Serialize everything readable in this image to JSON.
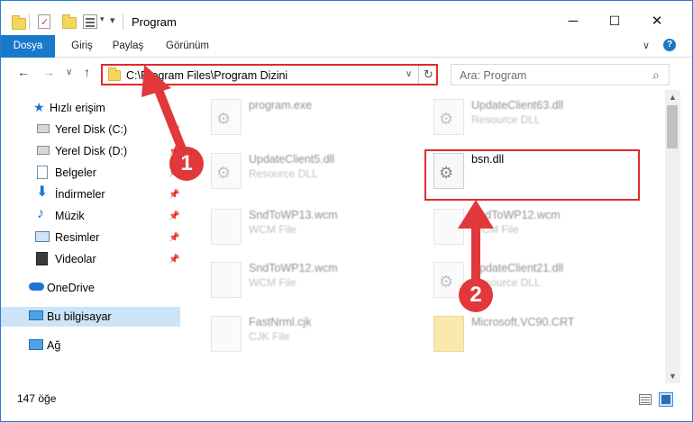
{
  "window": {
    "title": "Program",
    "minimize": "─",
    "maximize": "☐",
    "close": "✕",
    "ribbon_expand": "∨",
    "help": "?"
  },
  "ribbon": {
    "tabs": [
      {
        "label": "Dosya",
        "active": true
      },
      {
        "label": "Giriş",
        "active": false
      },
      {
        "label": "Paylaş",
        "active": false
      },
      {
        "label": "Görünüm",
        "active": false
      }
    ]
  },
  "addressbar": {
    "path": "C:\\Program Files\\Program Dizini",
    "back": "←",
    "forward": "→",
    "recent": "∨",
    "up": "↑",
    "dropdown": "∨",
    "refresh": "↻"
  },
  "search": {
    "placeholder": "Ara: Program",
    "icon": "⌕"
  },
  "sidebar": {
    "items": [
      {
        "label": "Hızlı erişim",
        "icon": "star-icon",
        "pinned": false
      },
      {
        "label": "Yerel Disk (C:)",
        "icon": "drive-icon",
        "pinned": true
      },
      {
        "label": "Yerel Disk (D:)",
        "icon": "drive-icon",
        "pinned": true
      },
      {
        "label": "Belgeler",
        "icon": "document-icon",
        "pinned": true
      },
      {
        "label": "İndirmeler",
        "icon": "download-icon",
        "pinned": true
      },
      {
        "label": "Müzik",
        "icon": "music-icon",
        "pinned": true
      },
      {
        "label": "Resimler",
        "icon": "picture-icon",
        "pinned": true
      },
      {
        "label": "Videolar",
        "icon": "video-icon",
        "pinned": true
      },
      {
        "label": "OneDrive",
        "icon": "cloud-icon",
        "pinned": false
      },
      {
        "label": "Bu bilgisayar",
        "icon": "computer-icon",
        "pinned": false,
        "selected": true
      },
      {
        "label": "Ağ",
        "icon": "network-icon",
        "pinned": false
      }
    ],
    "pin_glyph": "📌"
  },
  "files": [
    {
      "name": "program.exe",
      "type": ""
    },
    {
      "name": "UpdateClient63.dll",
      "type": "Resource DLL"
    },
    {
      "name": "UpdateClient5.dll",
      "type": "Resource DLL"
    },
    {
      "name": "bsn.dll",
      "type": ""
    },
    {
      "name": "SndToWP13.wcm",
      "type": "WCM File"
    },
    {
      "name": "SndToWP12.wcm",
      "type": "WCM File"
    },
    {
      "name": "SndToWP12.wcm",
      "type": "WCM File"
    },
    {
      "name": "UpdateClient21.dll",
      "type": "Resource DLL"
    },
    {
      "name": "FastNrml.cjk",
      "type": "CJK File"
    },
    {
      "name": "Microsoft.VC90.CRT",
      "type": ""
    }
  ],
  "callouts": {
    "one": "1",
    "two": "2"
  },
  "statusbar": {
    "count": "147 öğe"
  },
  "colors": {
    "accent": "#1979ca",
    "highlight": "#e02b2b",
    "selection": "#cce4f7"
  }
}
